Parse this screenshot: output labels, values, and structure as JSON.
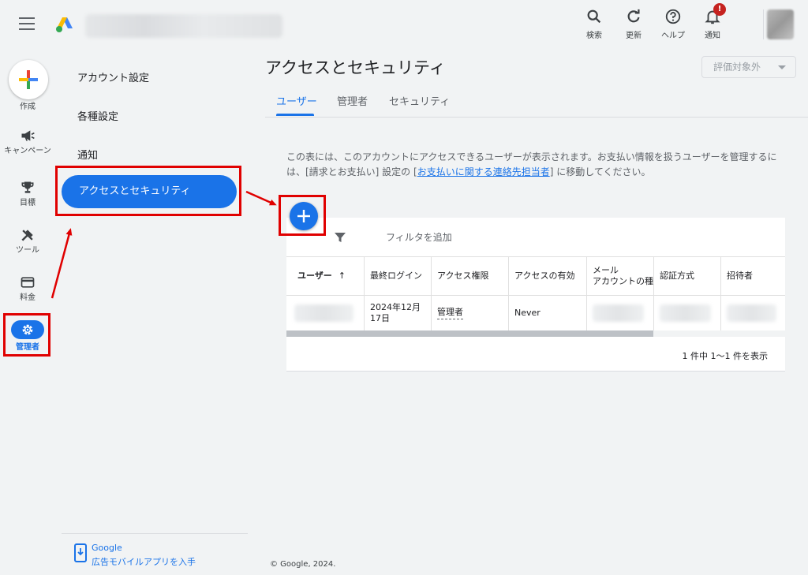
{
  "topbar": {
    "actions": [
      {
        "icon": "search-icon",
        "label": "検索"
      },
      {
        "icon": "refresh-icon",
        "label": "更新"
      },
      {
        "icon": "help-icon",
        "label": "ヘルプ"
      },
      {
        "icon": "bell-icon",
        "label": "通知",
        "badge": "!"
      }
    ]
  },
  "rail": {
    "create_label": "作成",
    "items": [
      {
        "icon": "megaphone-icon",
        "label": "キャンペーン"
      },
      {
        "icon": "trophy-icon",
        "label": "目標"
      },
      {
        "icon": "tools-icon",
        "label": "ツール"
      },
      {
        "icon": "billing-card-icon",
        "label": "料金"
      },
      {
        "icon": "gear-icon",
        "label": "管理者",
        "active": true
      }
    ]
  },
  "subnav": {
    "items": [
      "アカウント設定",
      "各種設定",
      "通知"
    ],
    "active_item": "アクセスとセキュリティ",
    "footer": {
      "line1": "Google",
      "line2": "広告モバイルアプリを入手"
    }
  },
  "main": {
    "title": "アクセスとセキュリティ",
    "eval_select": "評価対象外",
    "tabs": [
      {
        "label": "ユーザー",
        "active": true
      },
      {
        "label": "管理者",
        "active": false
      },
      {
        "label": "セキュリティ",
        "active": false
      }
    ],
    "description_part1": "この表には、このアカウントにアクセスできるユーザーが表示されます。お支払い情報を扱うユーザーを管理するには、[請求とお支払い] 設定の [",
    "description_link": "お支払いに関する連絡先担当者",
    "description_part2": "] に移動してください。",
    "filter_text": "フィルタを追加",
    "table": {
      "headers": [
        "ユーザー",
        "最終ログイン",
        "アクセス権限",
        "アクセスの有効",
        "メール\nアカウントの種",
        "認証方式",
        "招待者"
      ],
      "sort_indicator": "↑",
      "row": {
        "last_login": "2024年12月17日",
        "access": "管理者",
        "expiry": "Never"
      },
      "pager": "1 件中 1〜1 件を表示"
    },
    "copyright": "© Google, 2024."
  },
  "colors": {
    "accent": "#1a73e8",
    "highlight_red": "#e00000",
    "background": "#f1f3f4"
  }
}
